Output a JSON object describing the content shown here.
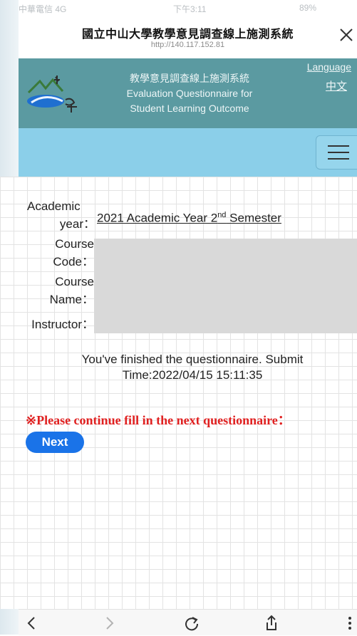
{
  "status_bar": {
    "carrier": "中華電信 4G",
    "time": "下午3:11",
    "battery": "89%"
  },
  "browser": {
    "title": "國立中山大學教學意見調查線上施測系統",
    "url": "http://140.117.152.81"
  },
  "banner": {
    "title_zh": "教學意見調查線上施測系統",
    "title_en_line1": "Evaluation Questionnaire for",
    "title_en_line2": "Student Learning Outcome",
    "language_label": "Language",
    "language_option": "中文"
  },
  "course_info": {
    "academic_label_1": "Academic",
    "academic_label_2": "year：",
    "academic_value_prefix": "2021 Academic Year 2",
    "academic_value_sup": "nd",
    "academic_value_suffix": " Semester",
    "course_code_label_1": "Course",
    "course_code_label_2": "Code：",
    "course_name_label_1": "Course",
    "course_name_label_2": "Name：",
    "instructor_label": "Instructor："
  },
  "message": {
    "finished": "You've finished the questionnaire. Submit Time:2022/04/15 15:11:35"
  },
  "notice": {
    "continue": "※Please continue fill in the next questionnaire："
  },
  "actions": {
    "next_label": "Next"
  }
}
